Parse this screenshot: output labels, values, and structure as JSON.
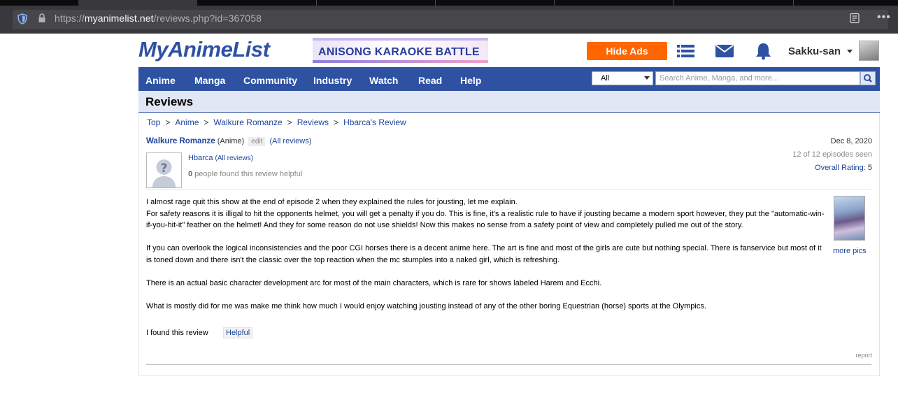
{
  "browser": {
    "url_prefix": "https://",
    "url_host": "myanimelist.net",
    "url_path": "/reviews.php?id=367058"
  },
  "header": {
    "logo": "MyAnimeList",
    "banner_text": "ANISONG KARAOKE BATTLE",
    "hide_ads": "Hide Ads",
    "username": "Sakku-san"
  },
  "nav": {
    "items": [
      "Anime",
      "Manga",
      "Community",
      "Industry",
      "Watch",
      "Read",
      "Help"
    ],
    "search_category": "All",
    "search_placeholder": "Search Anime, Manga, and more..."
  },
  "page": {
    "title": "Reviews",
    "breadcrumb": [
      "Top",
      "Anime",
      "Walkure Romanze",
      "Reviews",
      "Hbarca's Review"
    ],
    "breadcrumb_sep": ">"
  },
  "review": {
    "anime_title": "Walkure Romanze",
    "anime_type": "(Anime)",
    "edit": "edit",
    "all_reviews_link": "(All reviews)",
    "date": "Dec 8, 2020",
    "episodes_seen": "12 of 12 episodes seen",
    "overall_rating_label": "Overall Rating:",
    "overall_rating_value": "5",
    "reviewer": "Hbarca",
    "reviewer_all_reviews": "(All reviews)",
    "helpful_count": "0",
    "helpful_suffix": "people found this review helpful",
    "paragraphs": [
      "I almost rage quit this show at the end of episode 2 when they explained the rules for jousting, let me explain.",
      "For safety reasons it is illigal to hit the opponents helmet, you will get a penalty if you do. This is fine, it's a realistic rule to have if jousting became a modern sport however, they put the \"automatic-win-if-you-hit-it\" feather on the helmet! And they for some reason do not use shields! Now this makes no sense from a safety point of view and completely pulled me out of the story.",
      "If you can overlook the logical inconsistencies and the poor CGI horses there is a decent anime here. The art is fine and most of the girls are cute but nothing special. There is fanservice but most of it is toned down and there isn't the classic over the top reaction when the mc stumples into a naked girl, which is refreshing.",
      "There is an actual basic character development arc for most of the main characters, which is rare for shows labeled Harem and Ecchi.",
      "What is mostly did for me was make me think how much I would enjoy watching jousting instead of any of the other boring Equestrian (horse) sports at the Olympics."
    ],
    "more_pics": "more pics",
    "found_label": "I found this review",
    "helpful_button": "Helpful",
    "report": "report"
  },
  "colors": {
    "brand_blue": "#2e51a2",
    "link_blue": "#1c439b",
    "hide_ads_orange": "#ff6600",
    "title_bar_bg": "#e1e7f5"
  },
  "icons": [
    "shield-icon",
    "lock-icon",
    "reader-view-icon",
    "menu-dots-icon",
    "list-icon",
    "mail-icon",
    "bell-icon",
    "search-icon",
    "user-avatar",
    "default-user-icon"
  ]
}
